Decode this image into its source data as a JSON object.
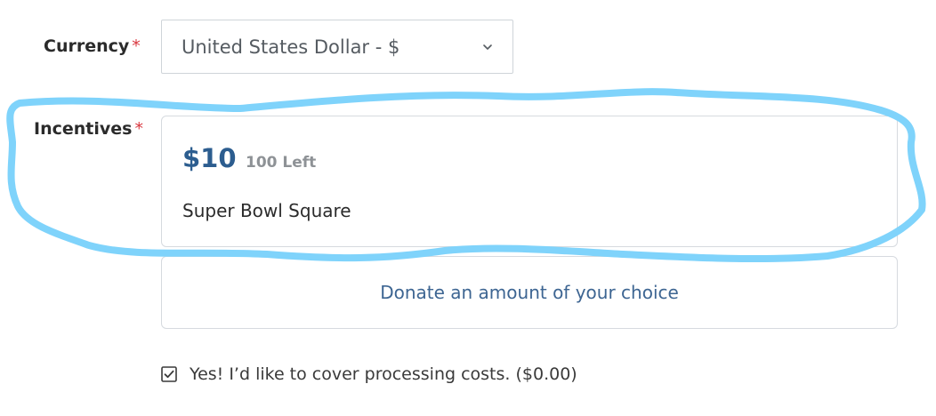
{
  "currency": {
    "label": "Currency",
    "required_mark": "*",
    "selected": "United States Dollar - $",
    "dropdown_icon": "chevron-down-icon"
  },
  "incentives": {
    "label": "Incentives",
    "required_mark": "*",
    "options": [
      {
        "price": "$10",
        "remaining": "100 Left",
        "title": "Super Bowl Square"
      }
    ],
    "custom_amount_label": "Donate an amount of your choice"
  },
  "processing": {
    "checked": true,
    "label": "Yes! I’d like to cover processing costs. ($0.00)"
  },
  "colors": {
    "highlight": "#7fd3fb",
    "price": "#2c5d8f",
    "required": "#d9363e"
  }
}
